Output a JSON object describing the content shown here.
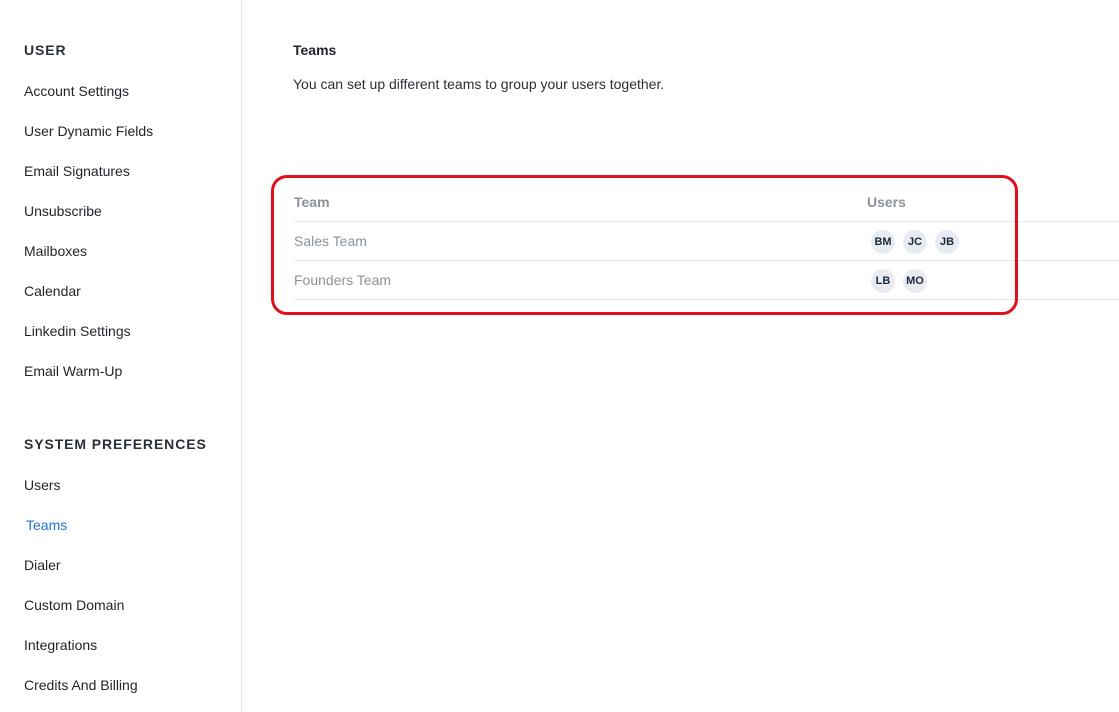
{
  "sidebar": {
    "user_section_title": "USER",
    "user_items": [
      "Account Settings",
      "User Dynamic Fields",
      "Email Signatures",
      "Unsubscribe",
      "Mailboxes",
      "Calendar",
      "Linkedin Settings",
      "Email Warm-Up"
    ],
    "system_section_title": "SYSTEM PREFERENCES",
    "system_items": [
      "Users",
      "Teams",
      "Dialer",
      "Custom Domain",
      "Integrations",
      "Credits And Billing"
    ],
    "active_item": "Teams"
  },
  "main": {
    "title": "Teams",
    "description": "You can set up different teams to group your users together.",
    "table": {
      "headers": {
        "team": "Team",
        "users": "Users"
      },
      "rows": [
        {
          "name": "Sales Team",
          "users": [
            "BM",
            "JC",
            "JB"
          ]
        },
        {
          "name": "Founders Team",
          "users": [
            "LB",
            "MO"
          ]
        }
      ]
    }
  },
  "colors": {
    "accent": "#1f74d1",
    "highlight": "#e0111b",
    "muted_text": "#8b929b",
    "avatar_bg": "#e8ecf1"
  }
}
